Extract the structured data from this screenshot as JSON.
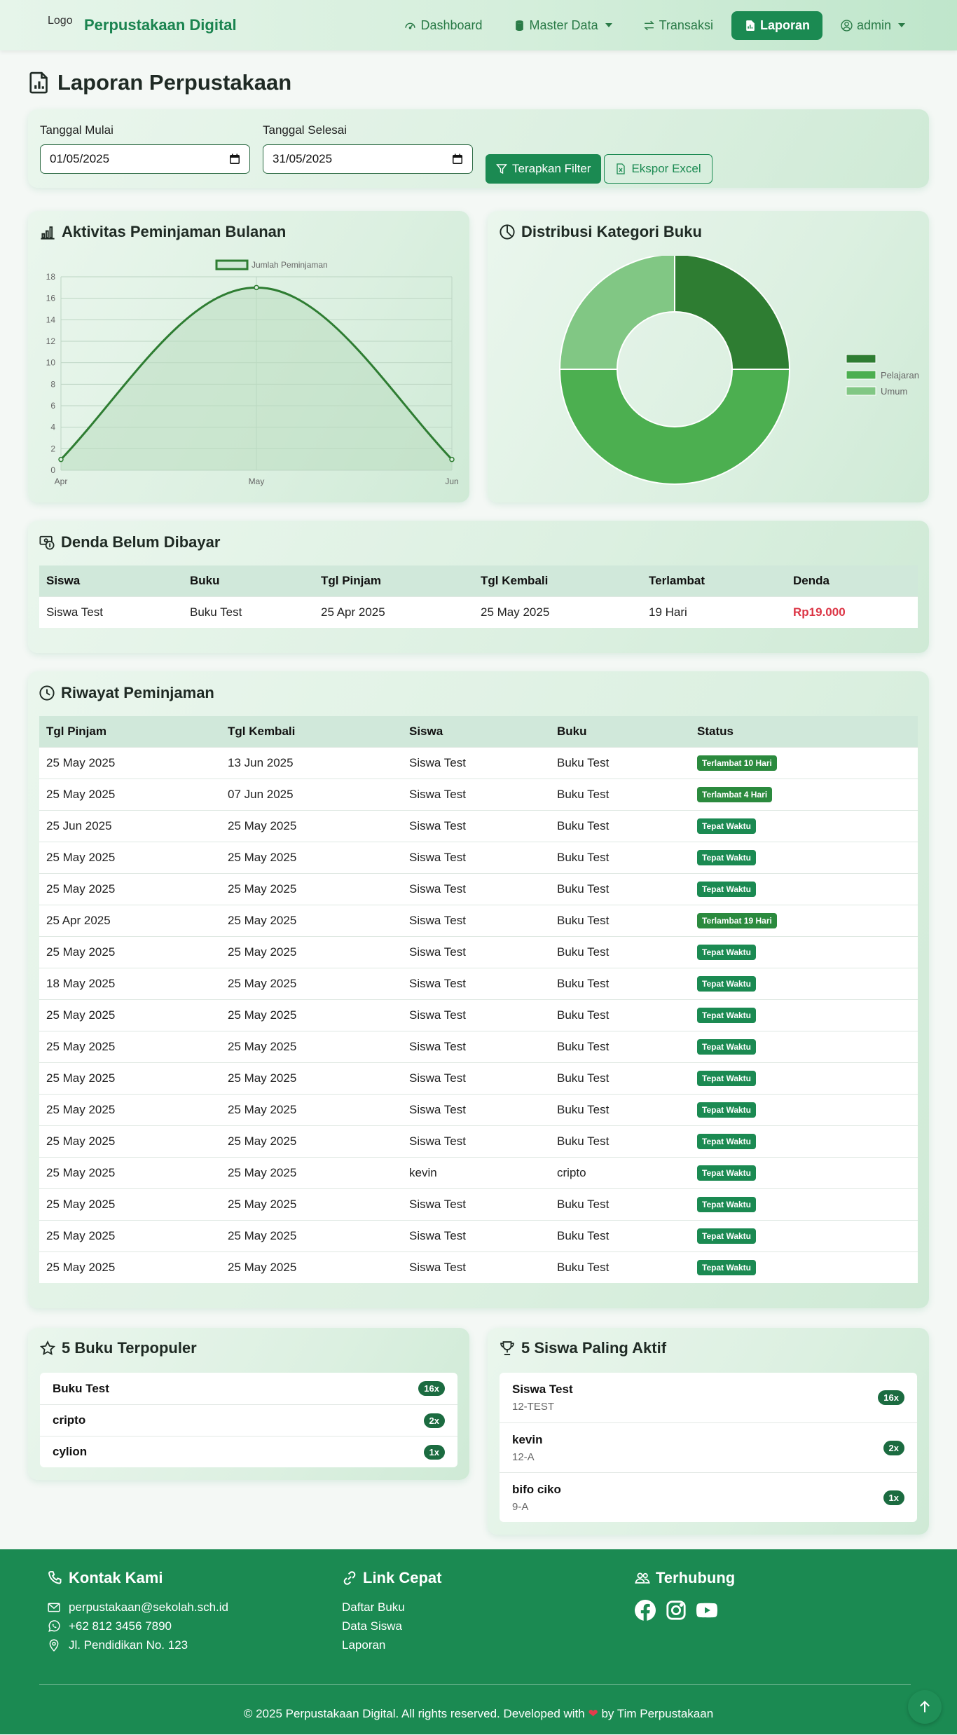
{
  "navbar": {
    "logo_alt": "Logo",
    "brand": "Perpustakaan Digital",
    "links": [
      {
        "label": "Dashboard",
        "icon": "speedometer-icon"
      },
      {
        "label": "Master Data",
        "icon": "database-icon"
      },
      {
        "label": "Transaksi",
        "icon": "arrows-swap-icon"
      },
      {
        "label": "Laporan",
        "icon": "file-report-icon",
        "active": true
      }
    ],
    "user": "admin"
  },
  "page": {
    "title": "Laporan Perpustakaan"
  },
  "filter": {
    "start_label": "Tanggal Mulai",
    "start_value": "01/05/2025",
    "end_label": "Tanggal Selesai",
    "end_value": "31/05/2025",
    "apply_label": "Terapkan Filter",
    "export_label": "Ekspor Excel"
  },
  "charts": {
    "loan_title": "Aktivitas Peminjaman Bulanan",
    "category_title": "Distribusi Kategori Buku"
  },
  "chart_data": [
    {
      "type": "area",
      "categories": [
        "Apr",
        "May",
        "Jun"
      ],
      "series": [
        {
          "name": "Jumlah Peminjaman",
          "values": [
            1,
            17,
            1
          ]
        }
      ],
      "ylim": [
        0,
        18
      ],
      "yticks": [
        0,
        2,
        4,
        6,
        8,
        10,
        12,
        14,
        16,
        18
      ],
      "grid": true,
      "legend": "top",
      "colors": {
        "line": "#2e7d32",
        "fill": "#b9ddbf"
      }
    },
    {
      "type": "pie",
      "labels": [
        "",
        "Pelajaran",
        "Umum"
      ],
      "values": [
        25,
        50,
        25
      ],
      "colors": [
        "#2e7d32",
        "#4caf50",
        "#81c784"
      ],
      "legend": "right",
      "donut": true
    }
  ],
  "fines": {
    "title": "Denda Belum Dibayar",
    "headers": [
      "Siswa",
      "Buku",
      "Tgl Pinjam",
      "Tgl Kembali",
      "Terlambat",
      "Denda"
    ],
    "rows": [
      [
        "Siswa Test",
        "Buku Test",
        "25 Apr 2025",
        "25 May 2025",
        "19 Hari",
        "Rp19.000"
      ]
    ]
  },
  "history": {
    "title": "Riwayat Peminjaman",
    "headers": [
      "Tgl Pinjam",
      "Tgl Kembali",
      "Siswa",
      "Buku",
      "Status"
    ],
    "rows": [
      [
        "25 May 2025",
        "13 Jun 2025",
        "Siswa Test",
        "Buku Test",
        "Terlambat 10 Hari"
      ],
      [
        "25 May 2025",
        "07 Jun 2025",
        "Siswa Test",
        "Buku Test",
        "Terlambat 4 Hari"
      ],
      [
        "25 Jun 2025",
        "25 May 2025",
        "Siswa Test",
        "Buku Test",
        "Tepat Waktu"
      ],
      [
        "25 May 2025",
        "25 May 2025",
        "Siswa Test",
        "Buku Test",
        "Tepat Waktu"
      ],
      [
        "25 May 2025",
        "25 May 2025",
        "Siswa Test",
        "Buku Test",
        "Tepat Waktu"
      ],
      [
        "25 Apr 2025",
        "25 May 2025",
        "Siswa Test",
        "Buku Test",
        "Terlambat 19 Hari"
      ],
      [
        "25 May 2025",
        "25 May 2025",
        "Siswa Test",
        "Buku Test",
        "Tepat Waktu"
      ],
      [
        "18 May 2025",
        "25 May 2025",
        "Siswa Test",
        "Buku Test",
        "Tepat Waktu"
      ],
      [
        "25 May 2025",
        "25 May 2025",
        "Siswa Test",
        "Buku Test",
        "Tepat Waktu"
      ],
      [
        "25 May 2025",
        "25 May 2025",
        "Siswa Test",
        "Buku Test",
        "Tepat Waktu"
      ],
      [
        "25 May 2025",
        "25 May 2025",
        "Siswa Test",
        "Buku Test",
        "Tepat Waktu"
      ],
      [
        "25 May 2025",
        "25 May 2025",
        "Siswa Test",
        "Buku Test",
        "Tepat Waktu"
      ],
      [
        "25 May 2025",
        "25 May 2025",
        "Siswa Test",
        "Buku Test",
        "Tepat Waktu"
      ],
      [
        "25 May 2025",
        "25 May 2025",
        "kevin",
        "cripto",
        "Tepat Waktu"
      ],
      [
        "25 May 2025",
        "25 May 2025",
        "Siswa Test",
        "Buku Test",
        "Tepat Waktu"
      ],
      [
        "25 May 2025",
        "25 May 2025",
        "Siswa Test",
        "Buku Test",
        "Tepat Waktu"
      ],
      [
        "25 May 2025",
        "25 May 2025",
        "Siswa Test",
        "Buku Test",
        "Tepat Waktu"
      ]
    ]
  },
  "popular_books": {
    "title": "5 Buku Terpopuler",
    "items": [
      {
        "name": "Buku Test",
        "count": "16x"
      },
      {
        "name": "cripto",
        "count": "2x"
      },
      {
        "name": "cylion",
        "count": "1x"
      }
    ]
  },
  "active_students": {
    "title": "5 Siswa Paling Aktif",
    "items": [
      {
        "name": "Siswa Test",
        "class": "12-TEST",
        "count": "16x"
      },
      {
        "name": "kevin",
        "class": "12-A",
        "count": "2x"
      },
      {
        "name": "bifo ciko",
        "class": "9-A",
        "count": "1x"
      }
    ]
  },
  "footer": {
    "contact_title": "Kontak Kami",
    "email": "perpustakaan@sekolah.sch.id",
    "phone": "+62 812 3456 7890",
    "address": "Jl. Pendidikan No. 123",
    "links_title": "Link Cepat",
    "links": [
      "Daftar Buku",
      "Data Siswa",
      "Laporan"
    ],
    "social_title": "Terhubung",
    "copyright_pre": "© 2025 Perpustakaan Digital. All rights reserved. Developed with",
    "copyright_post": "by Tim Perpustakaan"
  },
  "colors": {
    "primary": "#1b8a52",
    "danger": "#dc3545"
  }
}
